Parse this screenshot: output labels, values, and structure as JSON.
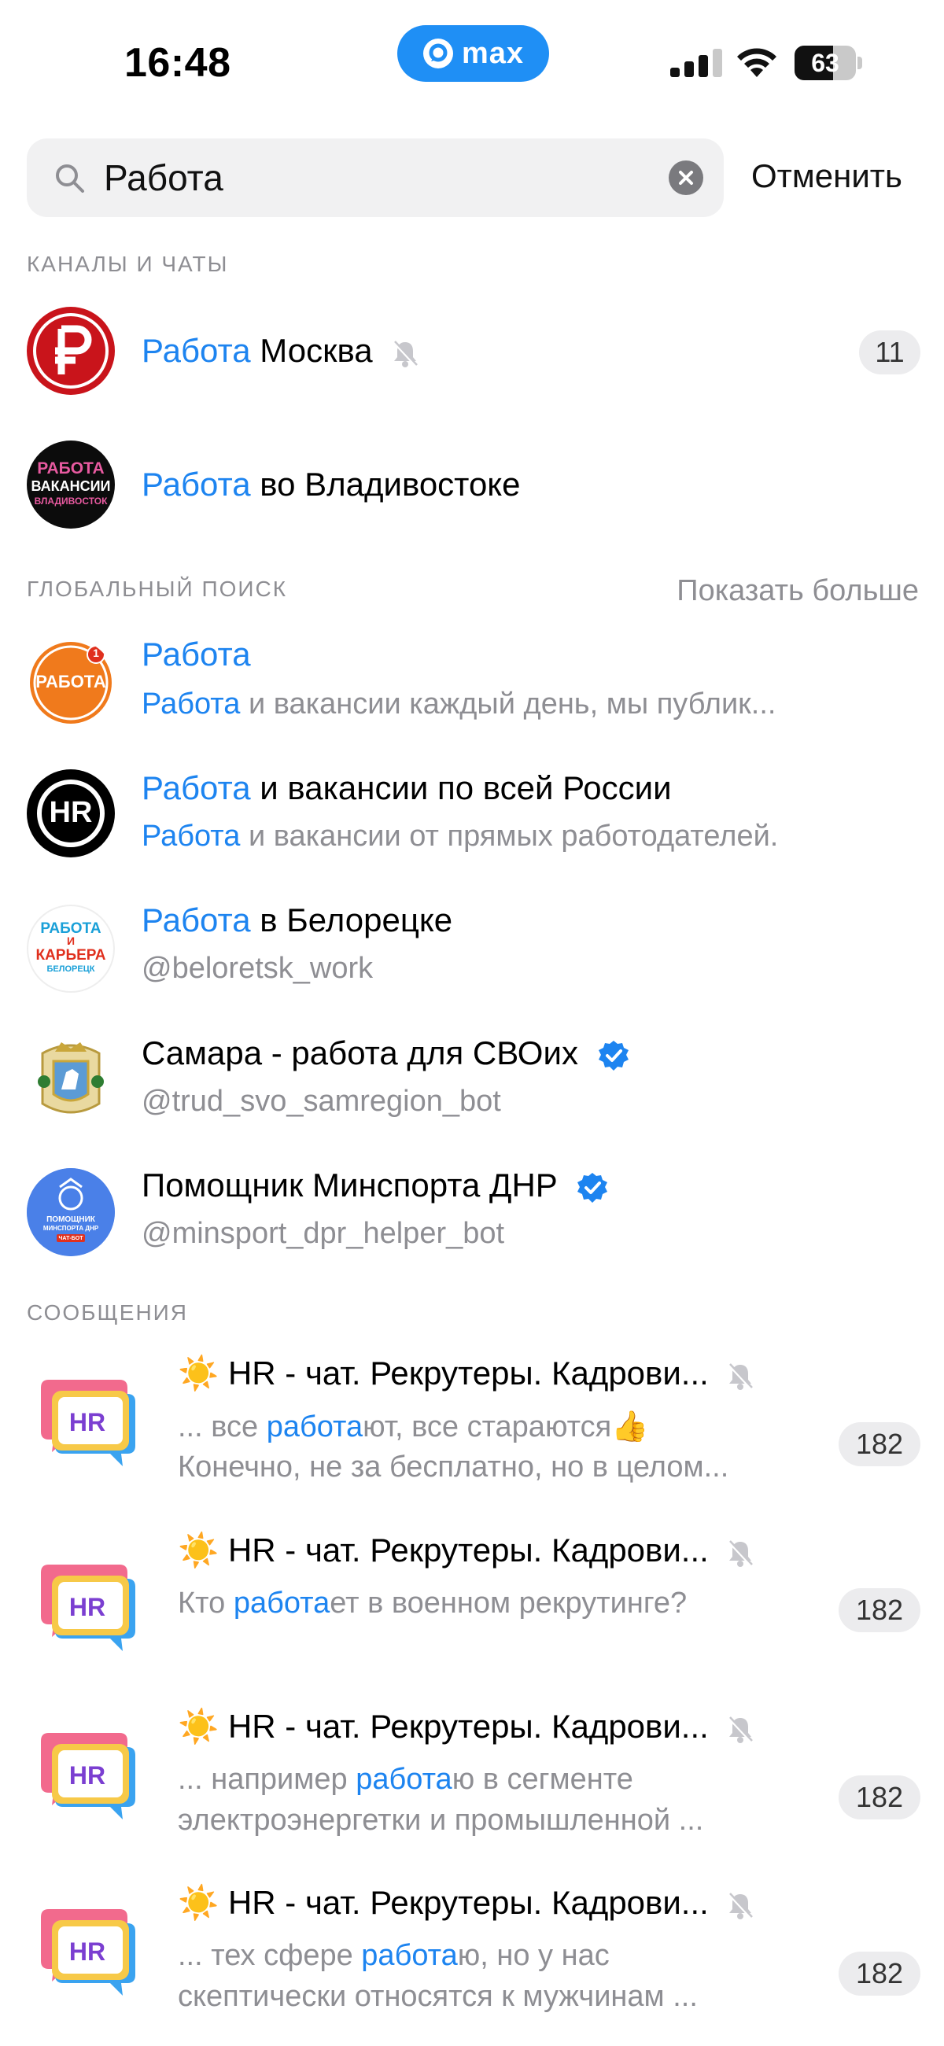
{
  "status_bar": {
    "time": "16:48",
    "app_pill": "max",
    "battery": "63",
    "battery_level": 0.63,
    "icons": [
      "signal-icon",
      "wifi-icon",
      "battery-icon"
    ]
  },
  "search": {
    "value": "Работа",
    "cancel_label": "Отменить"
  },
  "sections": {
    "channels": "КАНАЛЫ И ЧАТЫ",
    "global": "ГЛОБАЛЬНЫЙ ПОИСК",
    "global_more": "Показать больше",
    "messages": "СООБЩЕНИЯ"
  },
  "channels": [
    {
      "title_hl": "Работа",
      "title_rest": " Москва",
      "muted": true,
      "badge": "11"
    },
    {
      "title_hl": "Работа",
      "title_rest": " во Владивостоке",
      "avatar_text": [
        "РАБОТА",
        "ВАКАНСИИ",
        "ВЛАДИВОСТОК"
      ]
    }
  ],
  "global": [
    {
      "title_hl": "Работа",
      "title_rest": "",
      "sub_hl": "Работа",
      "sub_rest": " и вакансии каждый день, мы публик...",
      "avatar_text": "РАБОТА",
      "avatar_badge": "1"
    },
    {
      "title_hl": "Работа",
      "title_rest": " и вакансии по всей России",
      "sub_hl": "Работа",
      "sub_rest": " и вакансии от прямых работодателей.",
      "avatar_text": "HR"
    },
    {
      "title_hl": "Работа",
      "title_rest": " в Белорецке",
      "sub": "@beloretsk_work",
      "avatar_text": [
        "РАБОТА",
        "И",
        "КАРЬЕРА",
        "БЕЛОРЕЦК"
      ]
    },
    {
      "title": "Самара - работа для СВОих",
      "verified": true,
      "sub": "@trud_svo_samregion_bot"
    },
    {
      "title": "Помощник Минспорта ДНР",
      "verified": true,
      "sub": "@minsport_dpr_helper_bot",
      "avatar_text": [
        "ПОМОЩНИК",
        "МИНСПОРТА ДНР",
        "ЧАТ-БОТ"
      ]
    }
  ],
  "messages": [
    {
      "emoji": "☀️",
      "title": "HR - чат. Рекрутеры. Кадрови...",
      "line1_pre": "... все ",
      "line1_hl": "работа",
      "line1_post": "ют, все стараются",
      "line1_emoji": "👍",
      "line2": "Конечно, не за бесплатно, но в целом...",
      "badge": "182"
    },
    {
      "emoji": "☀️",
      "title": "HR - чат. Рекрутеры. Кадрови...",
      "line1_pre": "Кто ",
      "line1_hl": "работа",
      "line1_post": "ет в военном рекрутинге?",
      "line2": "",
      "badge": "182"
    },
    {
      "emoji": "☀️",
      "title": "HR - чат. Рекрутеры. Кадрови...",
      "line1_pre": "... например ",
      "line1_hl": "работа",
      "line1_post": "ю в сегменте",
      "line2": "электроэнергетки и промышленной ...",
      "badge": "182"
    },
    {
      "emoji": "☀️",
      "title": "HR - чат. Рекрутеры. Кадрови...",
      "line1_pre": "... тех сфере ",
      "line1_hl": "работа",
      "line1_post": "ю, но у нас",
      "line2": "скептически относятся к мужчинам ...",
      "badge": "182"
    }
  ],
  "hr_avatar_label": "HR",
  "colors": {
    "accent": "#1d84f0",
    "pill": "#1f8ff5",
    "muted_text": "#8e8e93"
  }
}
